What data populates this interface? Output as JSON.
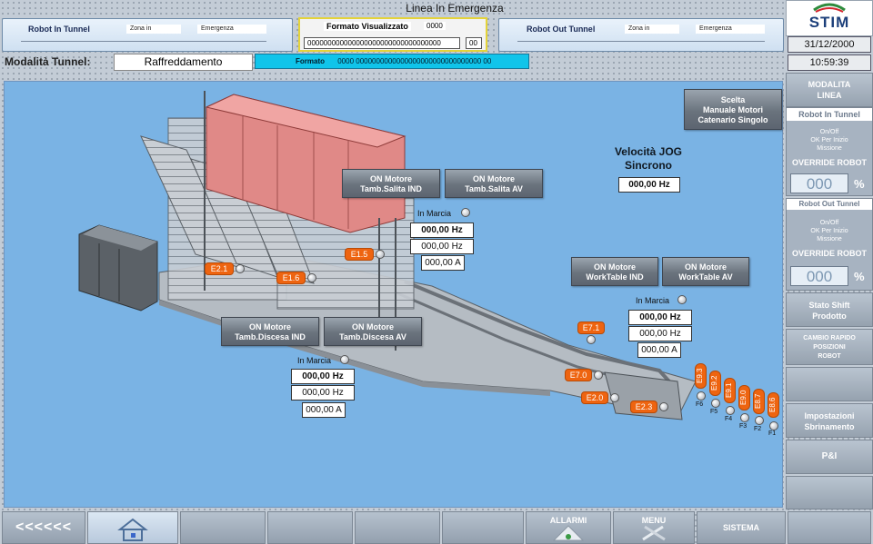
{
  "header": {
    "alarm_title": "Linea In Emergenza",
    "robot_in": {
      "title": "Robot In Tunnel",
      "zona": "Zona in",
      "emergenza": "Emergenza"
    },
    "robot_out": {
      "title": "Robot Out Tunnel",
      "zona": "Zona in",
      "emergenza": "Emergenza"
    },
    "formato_visualizzato": {
      "label": "Formato Visualizzato",
      "code": "0000",
      "digits": "000000000000000000000000000000000",
      "suffix": "00"
    },
    "modalita_label": "Modalità Tunnel:",
    "modalita_value": "Raffreddamento",
    "formato": {
      "label": "Formato",
      "value": "0000 0000000000000000000000000000000 00"
    }
  },
  "logo": {
    "text": "STIM"
  },
  "date": "31/12/2000",
  "time": "10:59:39",
  "main": {
    "scelta_button": "Scelta\nManuale Motori\nCatenario Singolo",
    "velocita_title": "Velocità JOG\nSincrono",
    "velocita_value": "000,00 Hz",
    "motors": [
      {
        "id": "salita-ind",
        "label": "ON Motore\nTamb.Salita IND"
      },
      {
        "id": "salita-av",
        "label": "ON Motore\nTamb.Salita AV"
      },
      {
        "id": "worktable-ind",
        "label": "ON Motore\nWorkTable IND"
      },
      {
        "id": "worktable-av",
        "label": "ON Motore\nWorkTable AV"
      },
      {
        "id": "discesa-ind",
        "label": "ON Motore\nTamb.Discesa IND"
      },
      {
        "id": "discesa-av",
        "label": "ON Motore\nTamb.Discesa AV"
      }
    ],
    "groups": [
      {
        "id": "salita",
        "in_marcia": "In Marcia",
        "hz_bold": "000,00 Hz",
        "hz": "000,00 Hz",
        "amp": "000,00 A"
      },
      {
        "id": "worktable",
        "in_marcia": "In Marcia",
        "hz_bold": "000,00 Hz",
        "hz": "000,00 Hz",
        "amp": "000,00 A"
      },
      {
        "id": "discesa",
        "in_marcia": "In Marcia",
        "hz_bold": "000,00 Hz",
        "hz": "000,00 Hz",
        "amp": "000,00 A"
      }
    ],
    "tags": [
      "E2.1",
      "E1.6",
      "E1.5",
      "E7.1",
      "E7.0",
      "E2.0",
      "E2.3"
    ],
    "vtags": [
      "E9.3",
      "E9.2",
      "E9.1",
      "E9.0",
      "E8.7",
      "E8.6"
    ],
    "ftags": [
      "F6",
      "F5",
      "F4",
      "F3",
      "F2",
      "F1"
    ]
  },
  "right_panel": {
    "modalita_linea": "MODALITA\nLINEA",
    "robot_in_header": "Robot In Tunnel",
    "onoff_in": "On/Off\nOK Per Inizio\nMissione",
    "override_in_label": "OVERRIDE ROBOT",
    "override_in_value": "000",
    "robot_out_header": "Robot Out Tunnel",
    "onoff_out": "On/Off\nOK Per Inizio\nMissione",
    "override_out_label": "OVERRIDE ROBOT",
    "override_out_value": "000",
    "percent": "%",
    "stato_shift": "Stato Shift\nProdotto",
    "cambio_rapido": "CAMBIO RAPIDO\nPOSIZIONI\nROBOT",
    "impostazioni": "Impostazioni\nSbrinamento",
    "pi": "P&I"
  },
  "bottom": {
    "back": "<<<<<<",
    "allarmi": "ALLARMI",
    "menu": "MENU",
    "sistema": "SISTEMA"
  },
  "colors": {
    "main_bg": "#7ab3e4",
    "tag": "#ee6410",
    "formato_bar": "#10c4ea",
    "accent_yellow": "#e4d33a"
  }
}
